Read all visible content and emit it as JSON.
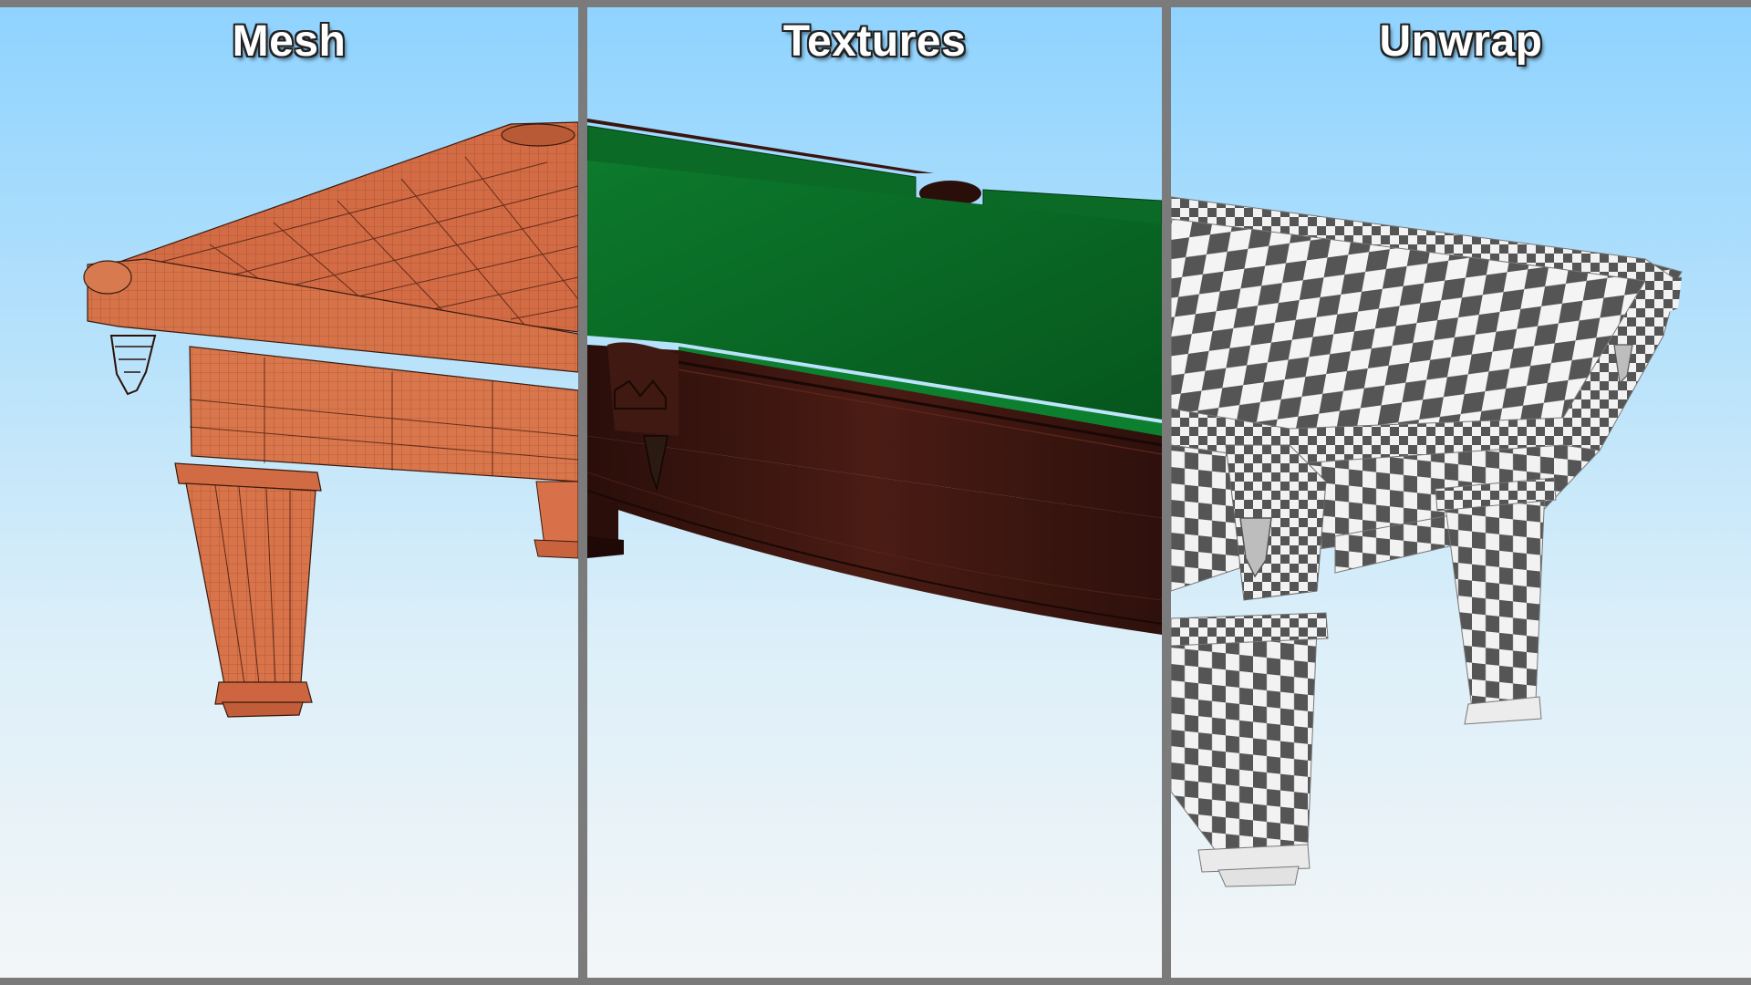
{
  "panels": [
    {
      "id": "mesh",
      "title": "Mesh",
      "render_style": "wireframe",
      "accent": "#d2693f"
    },
    {
      "id": "textures",
      "title": "Textures",
      "render_style": "textured",
      "cloth_color": "#0a6a26",
      "wood_color": "#3a1510"
    },
    {
      "id": "unwrap",
      "title": "Unwrap",
      "render_style": "uv-checker",
      "checker_dark": "#555555",
      "checker_light": "#f4f4f4"
    }
  ],
  "colors": {
    "background_top": "#8fd3ff",
    "background_bottom": "#f3f6f8",
    "divider": "#7b7b7b"
  }
}
